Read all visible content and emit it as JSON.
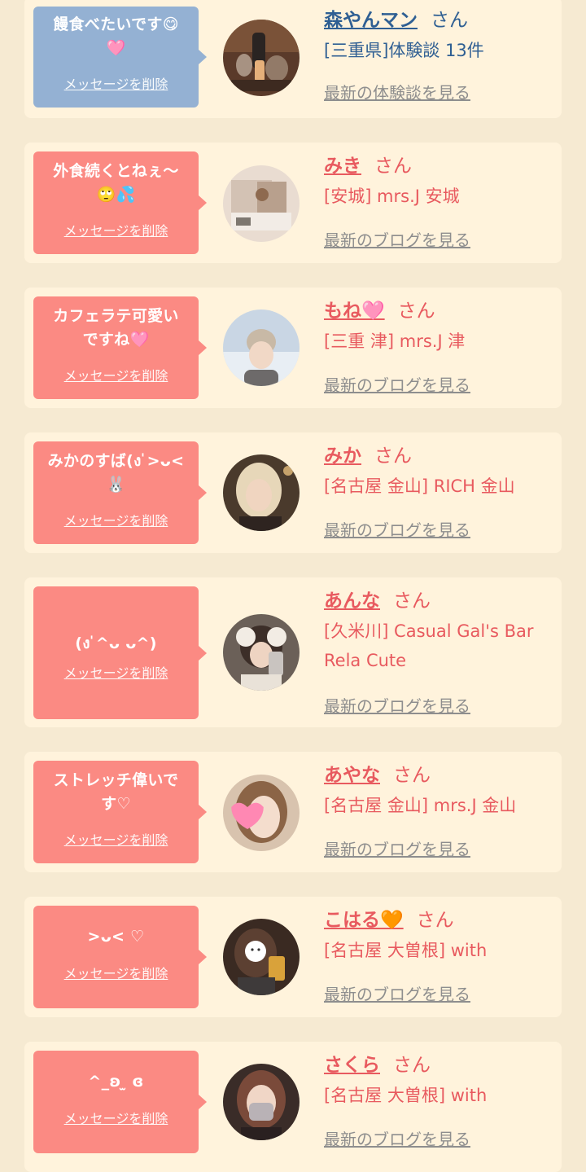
{
  "delete_label": "メッセージを削除",
  "san": "さん",
  "entries": [
    {
      "message": "饅食べたいです😋\n🩷",
      "name": "森やんマン",
      "shop": "[三重県]体験談 13件",
      "link": "最新の体験談を見る"
    },
    {
      "message": "外食続くとねぇ〜\n🙄💦",
      "name": "みき",
      "shop": "[安城] mrs.J 安城",
      "link": "最新のブログを見る"
    },
    {
      "message": "カフェラテ可愛い\nですね🩷",
      "name": "もね🩷",
      "shop": "[三重 津] mrs.J 津",
      "link": "最新のブログを見る"
    },
    {
      "message": "みかのすば(ง ̍>ᴗ<\n🐰",
      "name": "みか",
      "shop": "[名古屋 金山] RICH 金山",
      "link": "最新のブログを見る"
    },
    {
      "message": "(ง ̍^ᴗ ᴗ^)",
      "name": "あんな",
      "shop": "[久米川] Casual Gal's Bar\nRela Cute",
      "link": "最新のブログを見る"
    },
    {
      "message": "ストレッチ偉いで\nす♡",
      "name": "あやな",
      "shop": "[名古屋 金山] mrs.J 金山",
      "link": "最新のブログを見る"
    },
    {
      "message": ">ᴗ< ♡",
      "name": "こはる🧡",
      "shop": "[名古屋 大曽根] with",
      "link": "最新のブログを見る"
    },
    {
      "message": "^_ʚ ̫ ɞ",
      "name": "さくら",
      "shop": "[名古屋 大曽根] with",
      "link": "最新のブログを見る"
    }
  ]
}
